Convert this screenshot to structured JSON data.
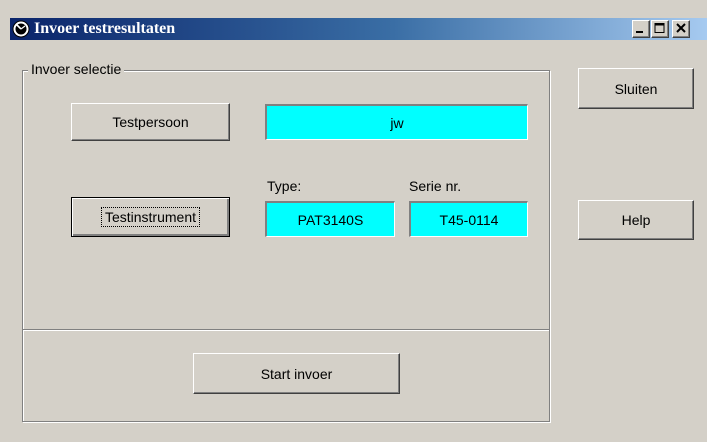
{
  "window": {
    "title": "Invoer testresultaten",
    "title_icon": "app-gauge-icon",
    "controls": [
      "minimize-icon",
      "maximize-icon",
      "close-icon"
    ]
  },
  "group": {
    "legend": "Invoer selectie"
  },
  "testpersoon": {
    "button_label": "Testpersoon",
    "value": "jw"
  },
  "testinstrument": {
    "button_label": "Testinstrument",
    "type_label": "Type:",
    "type_value": "PAT3140S",
    "serie_label": "Serie nr.",
    "serie_value": "T45-0114"
  },
  "actions": {
    "start_label": "Start invoer",
    "close_label": "Sluiten",
    "help_label": "Help"
  },
  "colors": {
    "field_background": "#00ffff",
    "titlebar_start": "#0a246a",
    "titlebar_end": "#a6caf0",
    "dialog_face": "#d4d0c8"
  }
}
